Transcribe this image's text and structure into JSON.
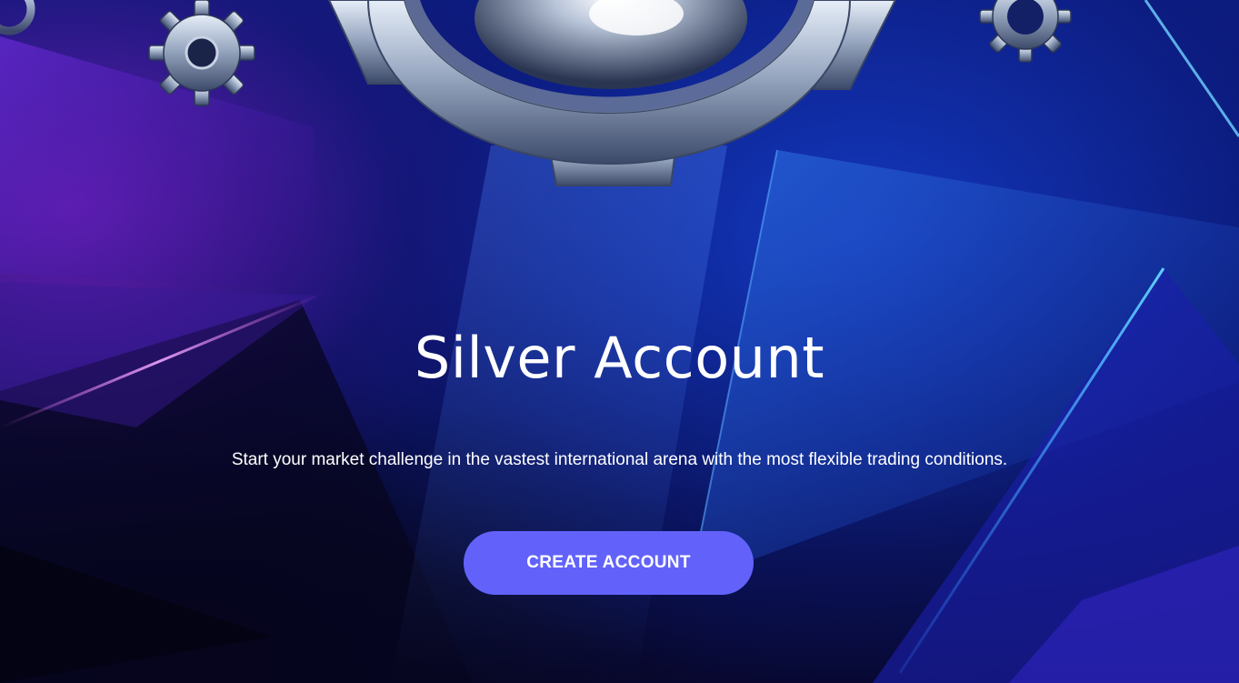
{
  "hero": {
    "title": "Silver Account",
    "subtitle": "Start your market challenge in the vastest international arena with the most flexible trading conditions.",
    "cta_label": "CREATE ACCOUNT"
  },
  "colors": {
    "background": "#0b1466",
    "accent_purple": "#7a1fc2",
    "button": "#6262fb",
    "text": "#ffffff"
  },
  "icons": [
    "gear-icon",
    "medal-emblem-icon"
  ]
}
